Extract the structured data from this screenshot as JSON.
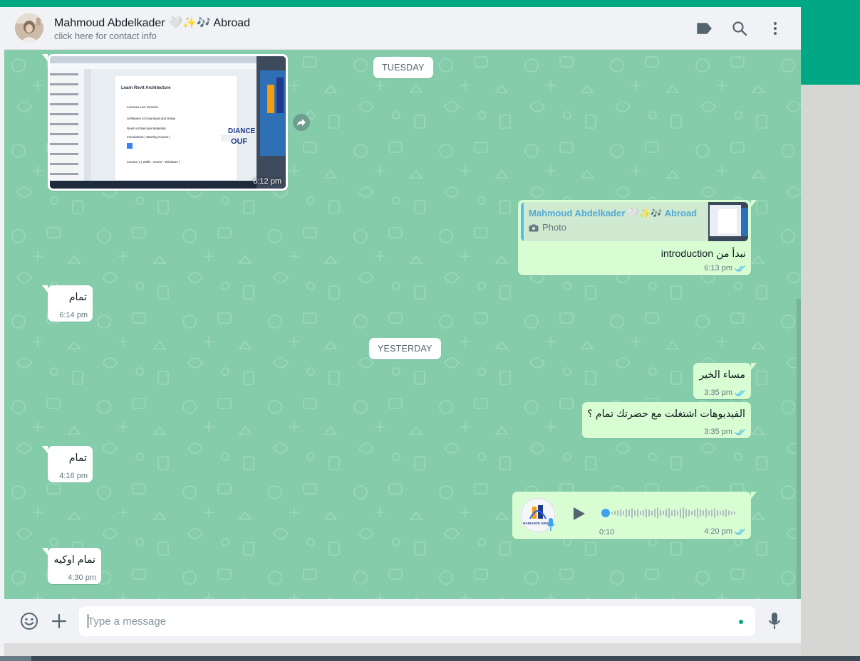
{
  "contact": {
    "name": "Mahmoud Abdelkader 🤍✨🎶 Abroad",
    "subtitle": "click here for contact info"
  },
  "day_separators": [
    "TUESDAY",
    "YESTERDAY"
  ],
  "image_message": {
    "time": "6:12 pm",
    "screen_title": "Learn Revit Architecture",
    "screen_items": [
      "Lectures Live Session",
      "Softwares to Download and Setup",
      "Revit Architecture Materials",
      "Introduction | Starting Course |",
      "Lecture 1 | Walls - Doors - Windows |"
    ],
    "screen_brand": "DIANCE",
    "screen_brand2": "OUF"
  },
  "reply_message": {
    "quoted_name": "Mahmoud Abdelkader 🤍✨🎶 Abroad",
    "quoted_type": "Photo",
    "text": "نبدأ من introduction",
    "time": "6:13 pm"
  },
  "messages": [
    {
      "id": "m1",
      "text": "تمام",
      "time": "6:14 pm"
    },
    {
      "id": "m2",
      "text": "مساء الخير",
      "time": "3:35 pm"
    },
    {
      "id": "m3",
      "text": "الفيديوهات اشتغلت مع حضرتك تمام ؟",
      "time": "3:35 pm"
    },
    {
      "id": "m4",
      "text": "تمام",
      "time": "4:16 pm"
    },
    {
      "id": "m6",
      "text": "تمام اوكيه",
      "time": "4:30 pm"
    }
  ],
  "voice_message": {
    "duration": "0:10",
    "time": "4:20 pm",
    "avatar_label": "RADIANCE GROUP",
    "progress": 0
  },
  "composer": {
    "placeholder": "Type a message"
  },
  "icons": {
    "header": [
      "label-icon",
      "search-icon",
      "menu-dots-icon"
    ],
    "footer": [
      "emoji-icon",
      "attach-plus-icon",
      "microphone-icon"
    ]
  },
  "colors": {
    "brand": "#00a884",
    "chat_background": "#84ccaa",
    "outgoing_bubble": "#d9fdd3",
    "incoming_bubble": "#ffffff",
    "read_ticks": "#53bdeb"
  }
}
